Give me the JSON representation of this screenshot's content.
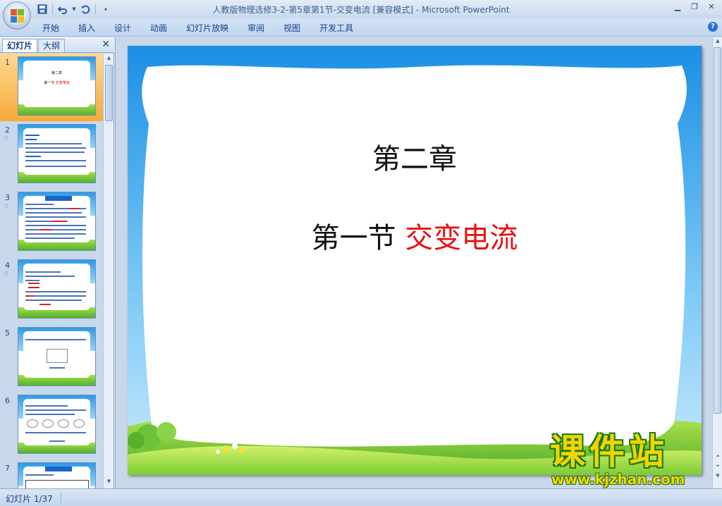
{
  "window": {
    "title": "人教版物理选修3-2-第5章第1节-交变电流 [兼容模式]",
    "app_name": "Microsoft PowerPoint",
    "separator": " - "
  },
  "quick_access": [
    "save-icon",
    "undo-icon",
    "redo-icon",
    "customize-icon"
  ],
  "ribbon": {
    "tabs": [
      "开始",
      "插入",
      "设计",
      "动画",
      "幻灯片放映",
      "审阅",
      "视图",
      "开发工具"
    ]
  },
  "left_pane": {
    "tabs": {
      "slides": "幻灯片",
      "outline": "大纲"
    },
    "close_glyph": "✕",
    "thumbnails": [
      {
        "num": "1",
        "kind": "title",
        "t1": "第二章",
        "t2a": "第一节 ",
        "t2b": "交变电流"
      },
      {
        "num": "2",
        "kind": "text",
        "star": "✩"
      },
      {
        "num": "3",
        "kind": "text-header",
        "star": "✩"
      },
      {
        "num": "4",
        "kind": "text",
        "star": "✩"
      },
      {
        "num": "5",
        "kind": "figure"
      },
      {
        "num": "6",
        "kind": "figure"
      },
      {
        "num": "7",
        "kind": "text-header"
      }
    ]
  },
  "slide": {
    "title": "第二章",
    "subtitle_prefix": "第一节 ",
    "subtitle_highlight": "交变电流",
    "highlight_color": "#e81010"
  },
  "watermark": {
    "big": "课件站",
    "url": "www.kjzhan.com"
  },
  "status": {
    "slide_counter": "幻灯片 1/37"
  }
}
